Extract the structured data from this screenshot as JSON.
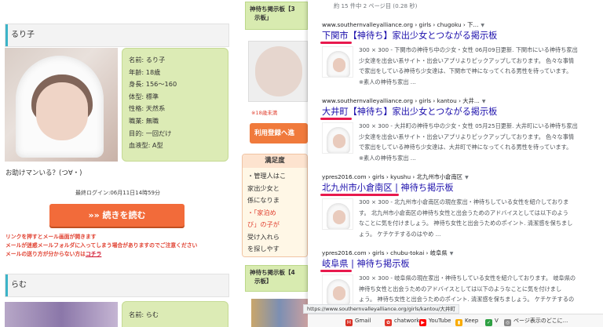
{
  "profile": {
    "header": "るり子",
    "rows": [
      "名前: るり子",
      "年齢: 18歳",
      "身長: 156〜160",
      "体型: 標準",
      "性格: 天然系",
      "職業: 無職",
      "目的: 一回だけ",
      "血液型: A型"
    ],
    "help_text": "お助けマンいる？(つ∀・)",
    "last_login": "最終ログイン:06月11日14時59分",
    "read_more": "»» 続きを読む",
    "warn1": "リンクを押すとメール画面が開きます",
    "warn2": "メールが迷惑メールフォルダに入ってしまう場合がありますのでご注意ください",
    "warn3_prefix": "メールの送り方が分からない方は",
    "warn3_link": "コチラ"
  },
  "profile2": {
    "header": "らむ",
    "rows": [
      "名前: らむ"
    ]
  },
  "middle": {
    "top_bar": "神待ち掲示板【3",
    "top_bar2": "示板」",
    "note": "※18歳未満",
    "register": "利用登録へ進",
    "manzoku_title": "満足度",
    "manzoku_lines": [
      "・管理人はこ",
      "家出少女と",
      "係になりま",
      "・「家泊め",
      "び」の子が",
      "受け入れら",
      "を探しやす"
    ],
    "bottom_bar": "神待ち掲示板【4",
    "bottom_bar2": "示板】"
  },
  "serp": {
    "stats": "約 15 件中 2 ページ目 (0.28 秒)",
    "results": [
      {
        "cite": "www.southernvalleyalliance.org › girls › chugoku › 下...",
        "title_hl": "下関市",
        "title_rest": "【神待ち】家出少女とつながる掲示板",
        "snippet": [
          "300 × 300 - 下関市の神待ち中の少女・女性 06月09日更新. 下関市にいる神待ち家出",
          "少女達を出会い系サイト・出会いアプリよりピックアップしております。 色々な事情",
          "で家出をしている神待ち少女達は、下関市で神になってくれる男性を待っています。",
          "※素人の神待ち家出 ..."
        ]
      },
      {
        "cite": "www.southernvalleyalliance.org › girls › kantou › 大井...",
        "title_hl": "大井町",
        "title_rest": "【神待ち】家出少女とつながる掲示板",
        "snippet": [
          "300 × 300 - 大井町の神待ち中の少女・女性 05月25日更新. 大井町にいる神待ち家出",
          "少女達を出会い系サイト・出会いアプリよりピックアップしております。 色々な事情",
          "で家出をしている神待ち少女達は、大井町で神になってくれる男性を待っています。",
          "※素人の神待ち家出 ..."
        ]
      },
      {
        "cite": "ypres2016.com › girls › kyushu › 北九州市小倉南区",
        "title_hl": "北九州市小倉南区",
        "title_rest": " | 神待ち掲示板",
        "snippet": [
          "300 × 300 - 北九州市小倉南区の現在家出・神待ちしている女性を紹介しておりま",
          "す。 北九州市小倉南区の神待ち女性と出会うためのアドバイスとしては以下のよう",
          "なことに気を付けましょう。 神待ち女性と出会うためのポイント. 清潔感を保ちまし",
          "ょう。 ケチケチするのはやめ ..."
        ]
      },
      {
        "cite": "ypres2016.com › girls › chubu-tokai › 岐阜県",
        "title_hl": "岐阜県",
        "title_rest": " | 神待ち掲示板",
        "snippet": [
          "300 × 300 - 岐阜県の現在家出・神待ちしている女性を紹介しております。 岐阜県の",
          "神待ち女性と出会うためのアドバイスとしては以下のようなことに気を付けまし",
          "ょう。 神待ち女性と出会うためのポイント. 清潔感を保ちましょう。 ケチケチするの"
        ]
      }
    ]
  },
  "status_url": "https://www.southernvalleyalliance.org/girls/kantou/大井町",
  "bookmarks": [
    {
      "label": "Gmail",
      "icon": "gmail-icon",
      "color": "#d93025"
    },
    {
      "label": "chatwork",
      "icon": "chatwork-icon",
      "color": "#e2392d"
    },
    {
      "label": "YouTube",
      "icon": "youtube-icon",
      "color": "#ff0000"
    },
    {
      "label": "Keep",
      "icon": "keep-icon",
      "color": "#f9ab00"
    },
    {
      "label": "V",
      "icon": "v-icon",
      "color": "#2ea043"
    },
    {
      "label": "ページ表示のどこに...",
      "icon": "globe-icon",
      "color": "#888888"
    }
  ],
  "colors": {
    "accent": "#3cb4c8",
    "button": "#f26b3a",
    "link": "#1a0dab",
    "highlight": "#e8194d"
  }
}
